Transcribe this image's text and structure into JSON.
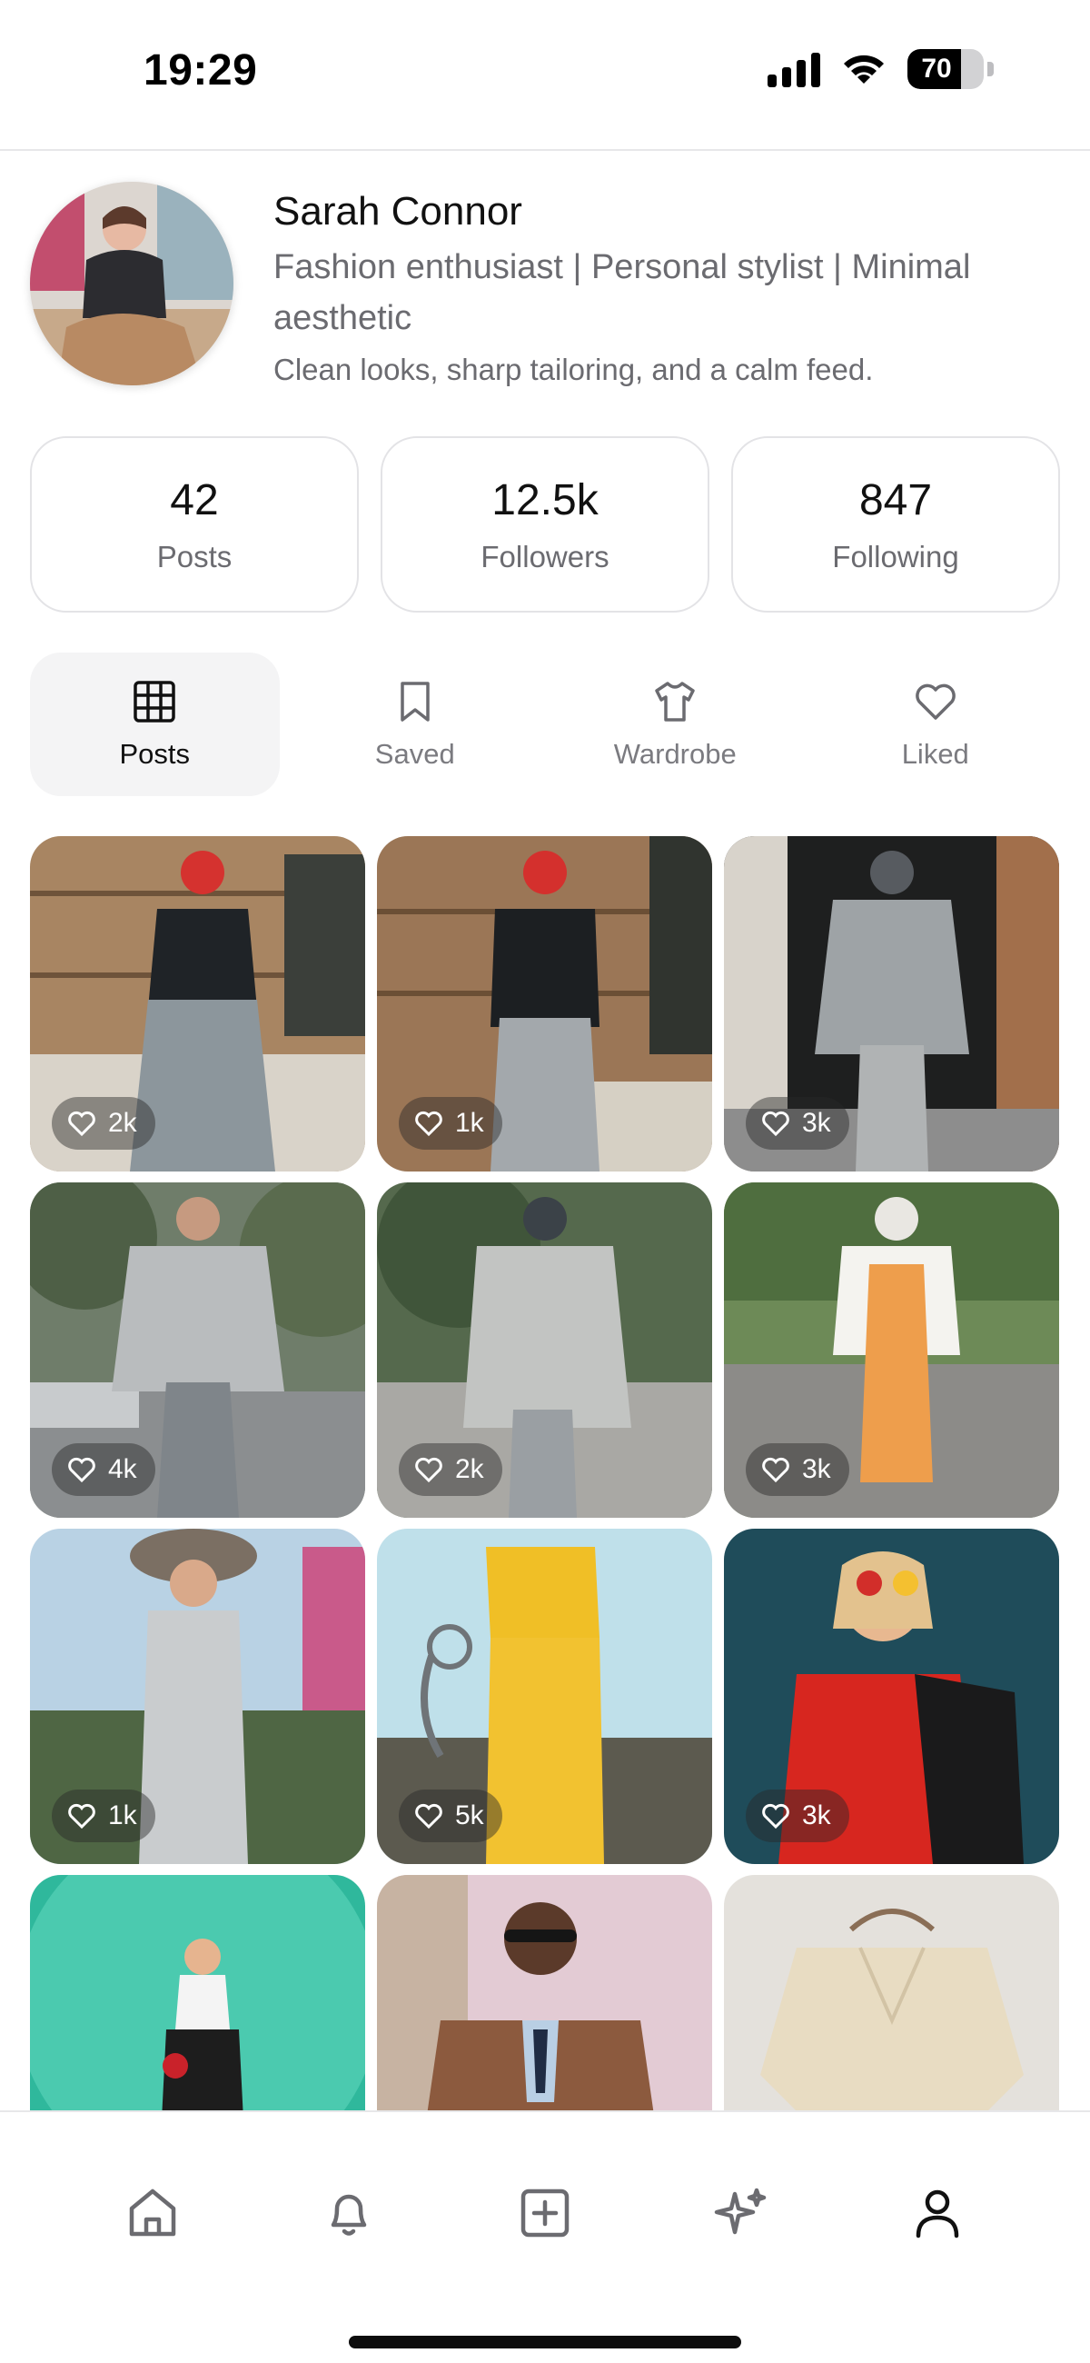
{
  "status": {
    "time": "19:29",
    "battery_level": "70",
    "battery_fraction": 0.7,
    "icons": [
      "signal-icon",
      "wifi-icon",
      "battery-icon"
    ]
  },
  "profile": {
    "name": "Sarah Connor",
    "bio": "Fashion enthusiast | Personal stylist | Minimal aesthetic",
    "tagline": "Clean looks, sharp tailoring, and a calm feed."
  },
  "stats": [
    {
      "value": "42",
      "label": "Posts"
    },
    {
      "value": "12.5k",
      "label": "Followers"
    },
    {
      "value": "847",
      "label": "Following"
    }
  ],
  "tabs": [
    {
      "label": "Posts",
      "icon": "grid-icon",
      "active": true
    },
    {
      "label": "Saved",
      "icon": "bookmark-icon",
      "active": false
    },
    {
      "label": "Wardrobe",
      "icon": "shirt-icon",
      "active": false
    },
    {
      "label": "Liked",
      "icon": "heart-icon",
      "active": false
    }
  ],
  "posts": [
    {
      "likes": "2k"
    },
    {
      "likes": "1k"
    },
    {
      "likes": "3k"
    },
    {
      "likes": "4k"
    },
    {
      "likes": "2k"
    },
    {
      "likes": "3k"
    },
    {
      "likes": "1k"
    },
    {
      "likes": "5k"
    },
    {
      "likes": "3k"
    },
    {
      "likes": ""
    },
    {
      "likes": ""
    },
    {
      "likes": ""
    }
  ],
  "bottom_nav": [
    "home-icon",
    "bell-icon",
    "plus-square-icon",
    "sparkle-icon",
    "user-icon"
  ],
  "colors": {
    "text_primary": "#111111",
    "text_secondary": "#6b6b70",
    "border": "#e3e3e6",
    "active_tab_bg": "#f4f4f5"
  }
}
